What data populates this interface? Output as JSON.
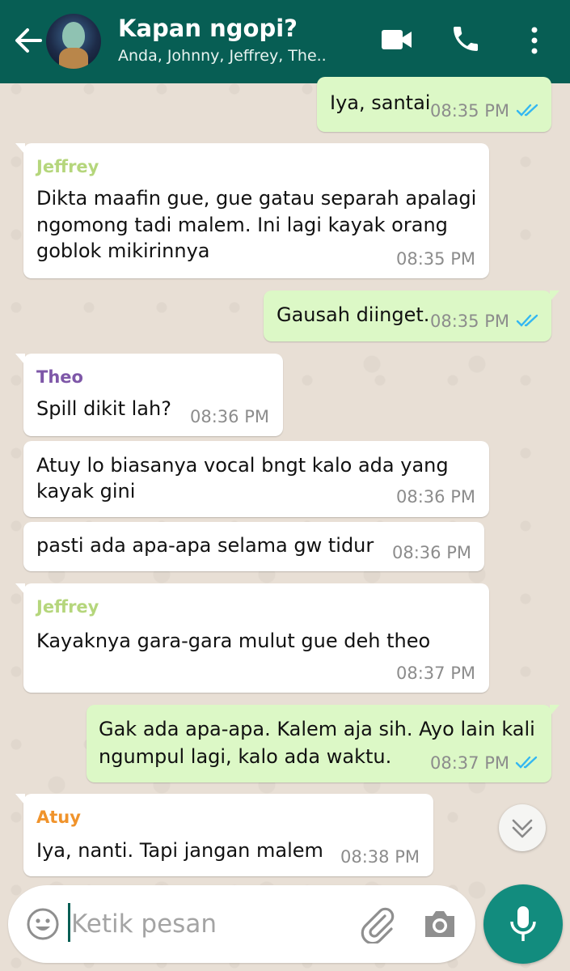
{
  "header": {
    "title": "Kapan ngopi?",
    "subtitle": "Anda, Johnny, Jeffrey, The..",
    "back_icon": "arrow-left-icon",
    "video_icon": "video-call-icon",
    "call_icon": "phone-icon",
    "menu_icon": "more-vertical-icon"
  },
  "colors": {
    "header": "#075e54",
    "outgoing_bubble": "#dcf8c6",
    "incoming_bubble": "#ffffff",
    "read_ticks": "#34b7f1",
    "mic_button": "#128c7e"
  },
  "messages": [
    {
      "direction": "out",
      "text": "Iya, santai",
      "time": "08:35 PM",
      "status": "read"
    },
    {
      "direction": "in",
      "sender": "Jeffrey",
      "sender_color": "#b5d67c",
      "lines": [
        "Dikta maafin gue, gue gatau separah apalagi",
        "ngomong tadi malem. Ini lagi kayak orang",
        "goblok mikirinnya"
      ],
      "time": "08:35 PM"
    },
    {
      "direction": "out",
      "text": "Gausah diinget.",
      "time": "08:35 PM",
      "status": "read"
    },
    {
      "direction": "in",
      "sender": "Theo",
      "sender_color": "#7e57a8",
      "text": "Spill dikit lah?",
      "time": "08:36 PM"
    },
    {
      "direction": "in",
      "lines": [
        "Atuy lo biasanya vocal bngt kalo ada yang",
        "kayak gini"
      ],
      "time": "08:36 PM"
    },
    {
      "direction": "in",
      "text": "pasti ada apa-apa selama gw tidur",
      "time": "08:36 PM"
    },
    {
      "direction": "in",
      "sender": "Jeffrey",
      "sender_color": "#b5d67c",
      "text": "Kayaknya gara-gara mulut gue deh theo",
      "time": "08:37 PM"
    },
    {
      "direction": "out",
      "lines": [
        "Gak ada apa-apa. Kalem aja sih. Ayo lain kali",
        "ngumpul lagi, kalo ada waktu."
      ],
      "time": "08:37 PM",
      "status": "read"
    },
    {
      "direction": "in",
      "sender": "Atuy",
      "sender_color": "#f0932b",
      "text": "Iya, nanti. Tapi jangan malem",
      "time": "08:38 PM"
    }
  ],
  "scroll_button_icon": "chevron-double-down-icon",
  "input": {
    "placeholder": "Ketik pesan",
    "emoji_icon": "emoji-icon",
    "attach_icon": "paperclip-icon",
    "camera_icon": "camera-icon",
    "mic_icon": "microphone-icon"
  }
}
